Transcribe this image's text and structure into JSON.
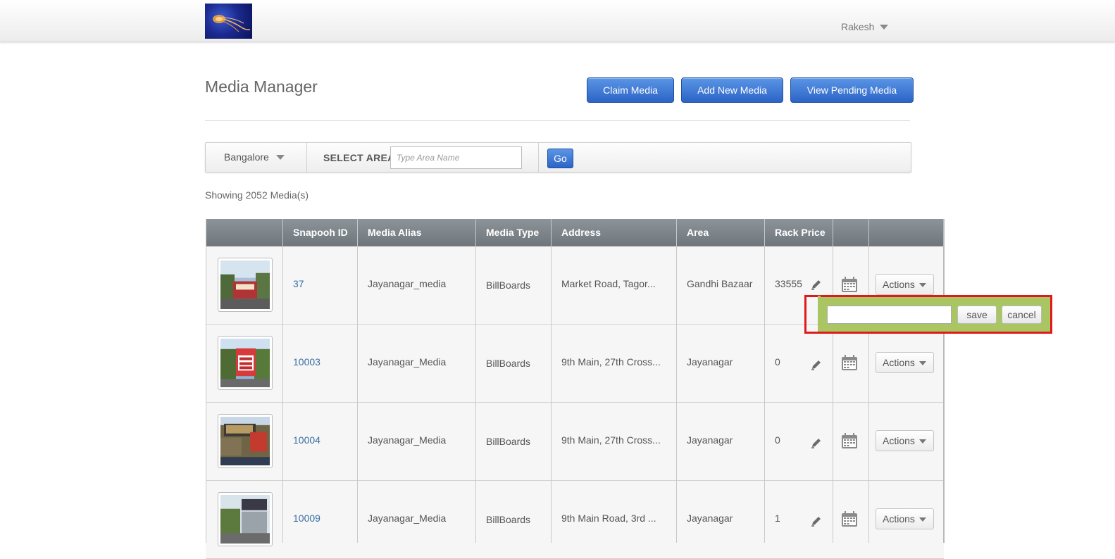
{
  "header": {
    "user_name": "Rakesh"
  },
  "page": {
    "title": "Media Manager",
    "buttons": {
      "claim": "Claim Media",
      "add": "Add New Media",
      "pending": "View Pending Media"
    }
  },
  "filter": {
    "city": "Bangalore",
    "area_label": "SELECT AREA",
    "area_placeholder": "Type Area Name",
    "go_label": "Go"
  },
  "showing_text": "Showing 2052 Media(s)",
  "table": {
    "columns": [
      "",
      "Snapooh ID",
      "Media Alias",
      "Media Type",
      "Address",
      "Area",
      "Rack Price",
      "",
      ""
    ],
    "rows": [
      {
        "id": "37",
        "alias": "Jayanagar_media",
        "type": "BillBoards",
        "address": "Market Road, Tagor...",
        "area": "Gandhi Bazaar",
        "price": "33555",
        "actions": "Actions"
      },
      {
        "id": "10003",
        "alias": "Jayanagar_Media",
        "type": "BillBoards",
        "address": "9th Main, 27th Cross...",
        "area": "Jayanagar",
        "price": "0",
        "actions": "Actions"
      },
      {
        "id": "10004",
        "alias": "Jayanagar_Media",
        "type": "BillBoards",
        "address": "9th Main, 27th Cross...",
        "area": "Jayanagar",
        "price": "0",
        "actions": "Actions"
      },
      {
        "id": "10009",
        "alias": "Jayanagar_Media",
        "type": "BillBoards",
        "address": "9th Main Road, 3rd ...",
        "area": "Jayanagar",
        "price": "1",
        "actions": "Actions"
      }
    ]
  },
  "price_editor": {
    "value": "",
    "save_label": "save",
    "cancel_label": "cancel"
  },
  "icons": {
    "logo": "jellyfish-logo",
    "user_menu": "chevron-down-icon",
    "edit": "pencil-icon",
    "schedule": "calendar-icon"
  },
  "colors": {
    "primary_button": "#2c64c6",
    "table_header": "#7d8489",
    "popup_bg": "#a9c662",
    "highlight_outline": "#e0191b",
    "link": "#3a6ea5"
  }
}
